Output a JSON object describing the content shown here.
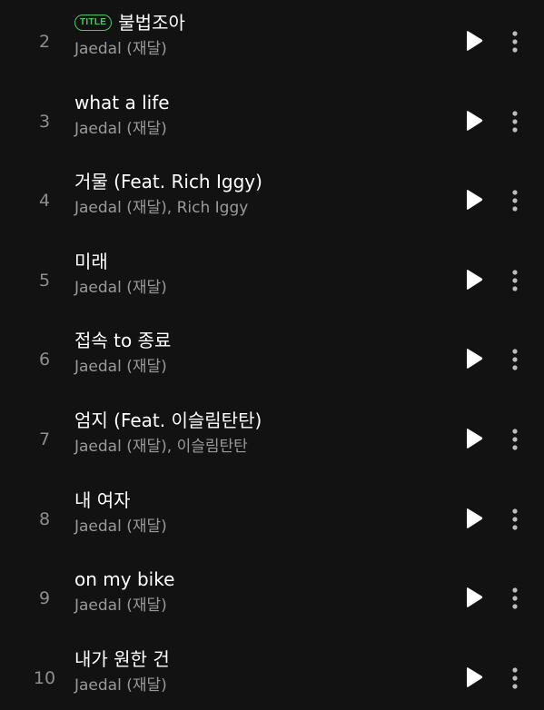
{
  "tracklist": {
    "tracks": [
      {
        "number": "2",
        "title": "불법조아",
        "badge": "TITLE",
        "artist": "Jaedal (재달)",
        "play_icon": "play-icon",
        "more_icon": "more-vertical-icon"
      },
      {
        "number": "3",
        "title": "what a life",
        "badge": "",
        "artist": "Jaedal (재달)",
        "play_icon": "play-icon",
        "more_icon": "more-vertical-icon"
      },
      {
        "number": "4",
        "title": "거물 (Feat. Rich Iggy)",
        "badge": "",
        "artist": "Jaedal (재달), Rich Iggy",
        "play_icon": "play-icon",
        "more_icon": "more-vertical-icon"
      },
      {
        "number": "5",
        "title": "미래",
        "badge": "",
        "artist": "Jaedal (재달)",
        "play_icon": "play-icon",
        "more_icon": "more-vertical-icon"
      },
      {
        "number": "6",
        "title": "접속 to 종료",
        "badge": "",
        "artist": "Jaedal (재달)",
        "play_icon": "play-icon",
        "more_icon": "more-vertical-icon"
      },
      {
        "number": "7",
        "title": "엄지 (Feat. 이슬림탄탄)",
        "badge": "",
        "artist": "Jaedal (재달), 이슬림탄탄",
        "play_icon": "play-icon",
        "more_icon": "more-vertical-icon"
      },
      {
        "number": "8",
        "title": "내 여자",
        "badge": "",
        "artist": "Jaedal (재달)",
        "play_icon": "play-icon",
        "more_icon": "more-vertical-icon"
      },
      {
        "number": "9",
        "title": "on my bike",
        "badge": "",
        "artist": "Jaedal (재달)",
        "play_icon": "play-icon",
        "more_icon": "more-vertical-icon"
      },
      {
        "number": "10",
        "title": "내가 원한 건",
        "badge": "",
        "artist": "Jaedal (재달)",
        "play_icon": "play-icon",
        "more_icon": "more-vertical-icon"
      }
    ]
  },
  "colors": {
    "background": "#121212",
    "title_text": "#ffffff",
    "secondary_text": "#9a9a9a",
    "track_number": "#8e8e8e",
    "badge_accent": "#4cc764",
    "icon": "#ffffff",
    "more_icon": "#bdbdbd"
  }
}
